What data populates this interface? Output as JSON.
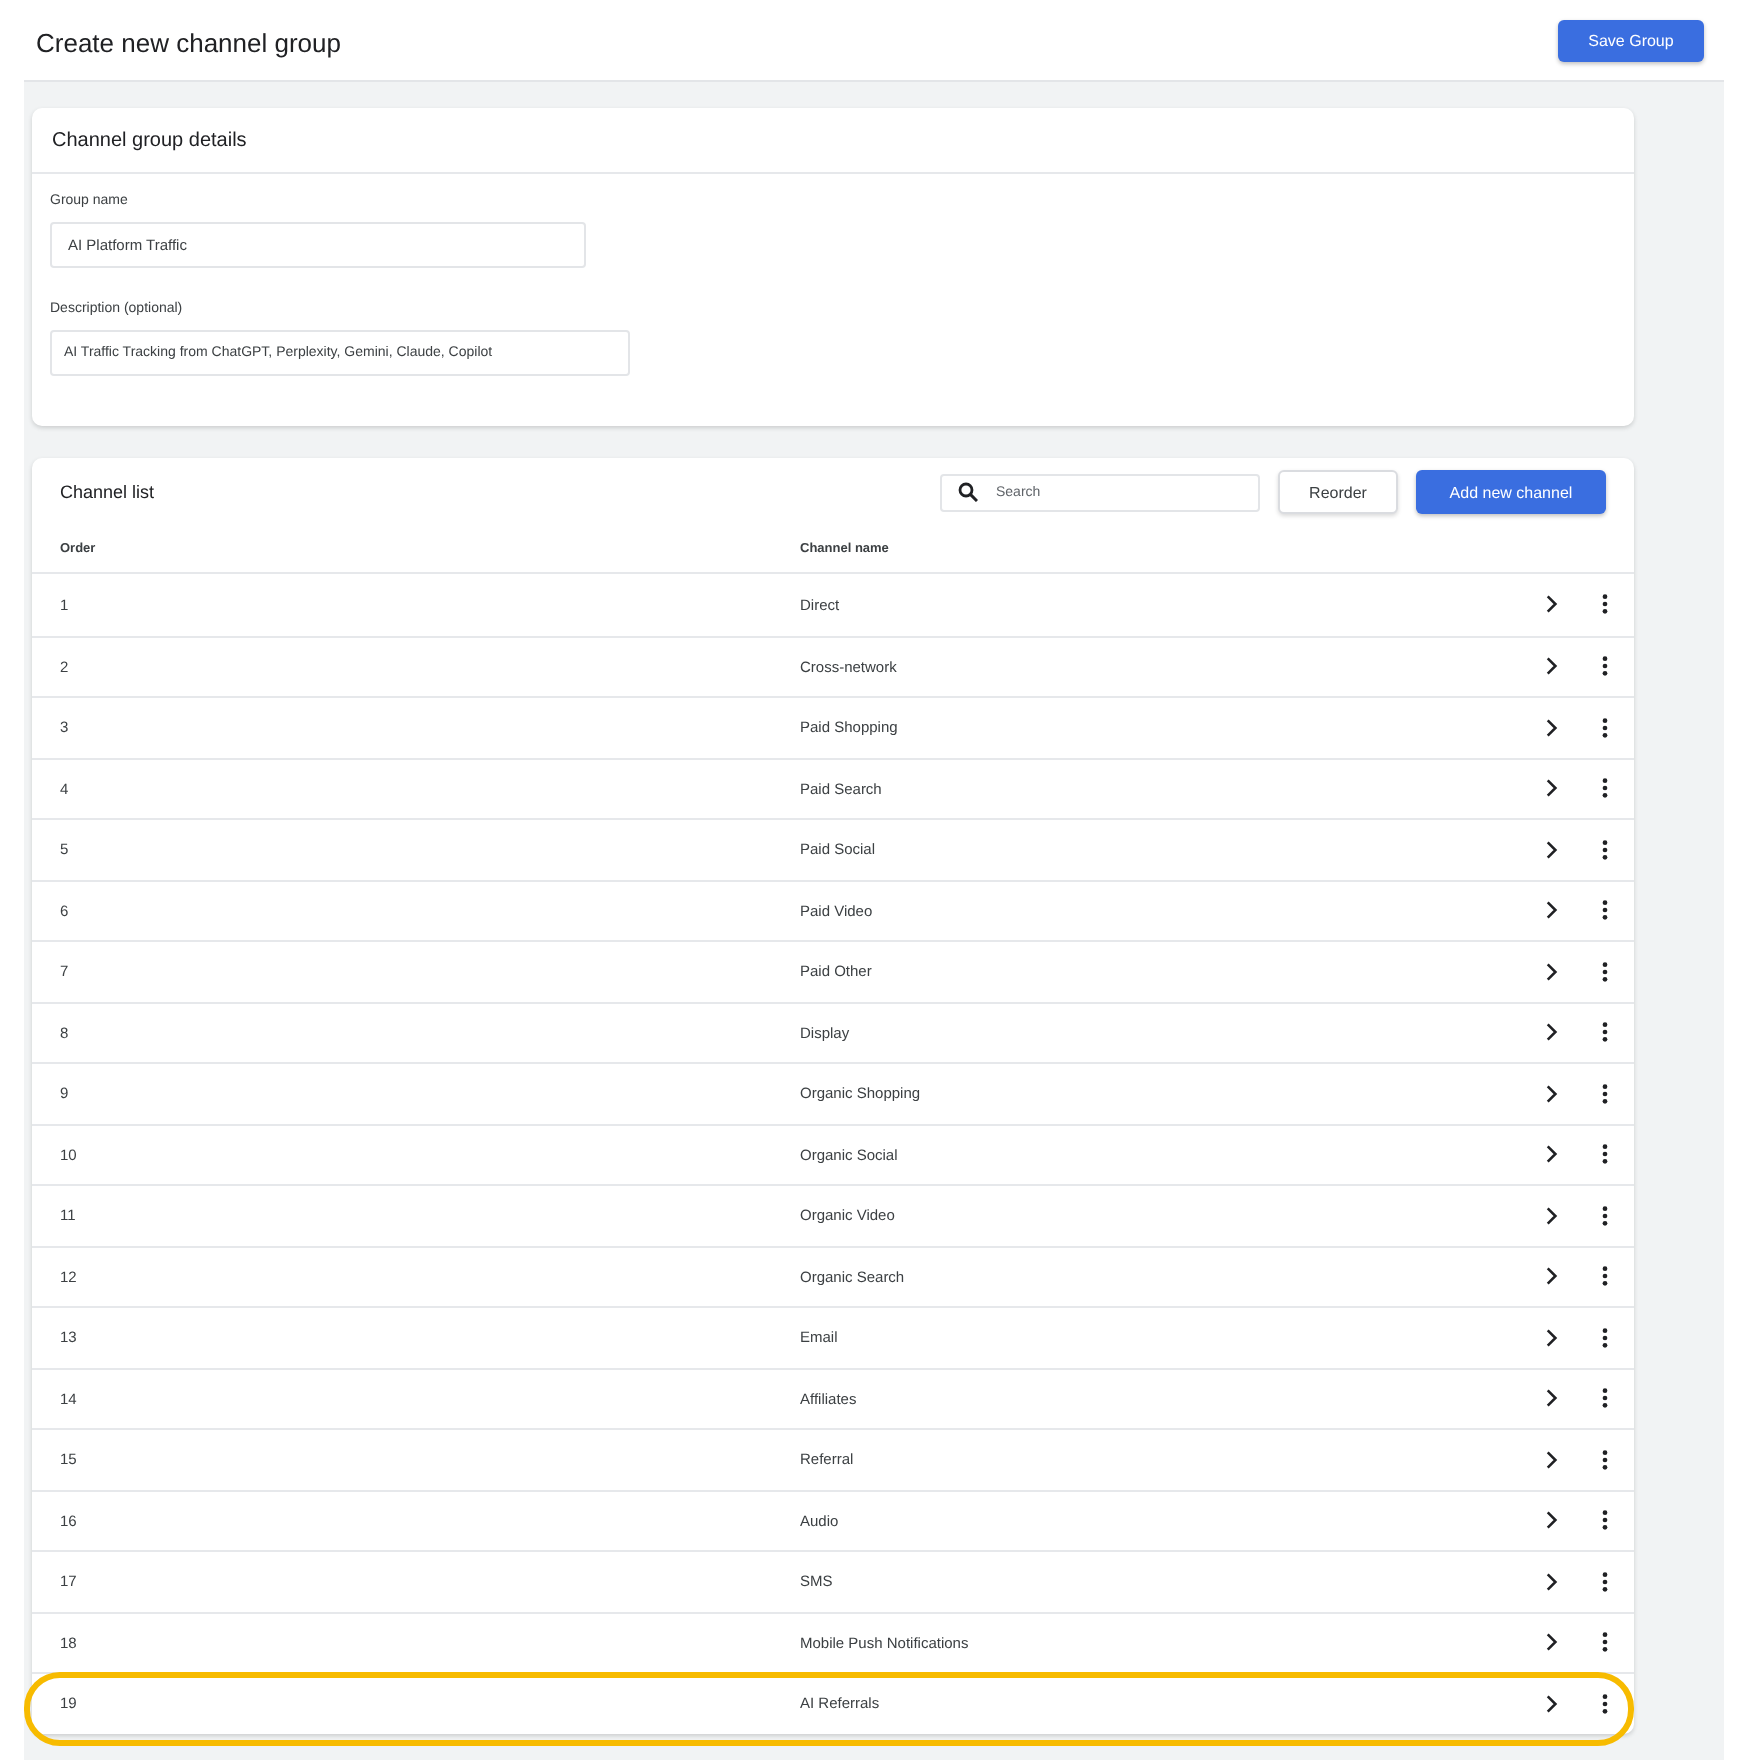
{
  "header": {
    "title": "Create new channel group",
    "save_button": "Save Group"
  },
  "details": {
    "title": "Channel group details",
    "fields": [
      {
        "label": "Group name",
        "value": "AI Platform Traffic"
      },
      {
        "label": "Description (optional)",
        "value": "AI Traffic Tracking from ChatGPT, Perplexity, Gemini, Claude, Copilot"
      }
    ]
  },
  "channel_list": {
    "title": "Channel list",
    "search": {
      "placeholder": "Search"
    },
    "buttons": [
      {
        "label": "Reorder",
        "kind": "secondary"
      },
      {
        "label": "Add new channel",
        "kind": "primary"
      }
    ],
    "columns": [
      "Order",
      "Channel name"
    ],
    "rows": [
      {
        "order": "1",
        "name": "Direct",
        "highlighted": false
      },
      {
        "order": "2",
        "name": "Cross-network",
        "highlighted": false
      },
      {
        "order": "3",
        "name": "Paid Shopping",
        "highlighted": false
      },
      {
        "order": "4",
        "name": "Paid Search",
        "highlighted": false
      },
      {
        "order": "5",
        "name": "Paid Social",
        "highlighted": false
      },
      {
        "order": "6",
        "name": "Paid Video",
        "highlighted": false
      },
      {
        "order": "7",
        "name": "Paid Other",
        "highlighted": false
      },
      {
        "order": "8",
        "name": "Display",
        "highlighted": false
      },
      {
        "order": "9",
        "name": "Organic Shopping",
        "highlighted": false
      },
      {
        "order": "10",
        "name": "Organic Social",
        "highlighted": false
      },
      {
        "order": "11",
        "name": "Organic Video",
        "highlighted": false
      },
      {
        "order": "12",
        "name": "Organic Search",
        "highlighted": false
      },
      {
        "order": "13",
        "name": "Email",
        "highlighted": false
      },
      {
        "order": "14",
        "name": "Affiliates",
        "highlighted": false
      },
      {
        "order": "15",
        "name": "Referral",
        "highlighted": false
      },
      {
        "order": "16",
        "name": "Audio",
        "highlighted": false
      },
      {
        "order": "17",
        "name": "SMS",
        "highlighted": false
      },
      {
        "order": "18",
        "name": "Mobile Push Notifications",
        "highlighted": false
      },
      {
        "order": "19",
        "name": "AI Referrals",
        "highlighted": true
      }
    ]
  }
}
